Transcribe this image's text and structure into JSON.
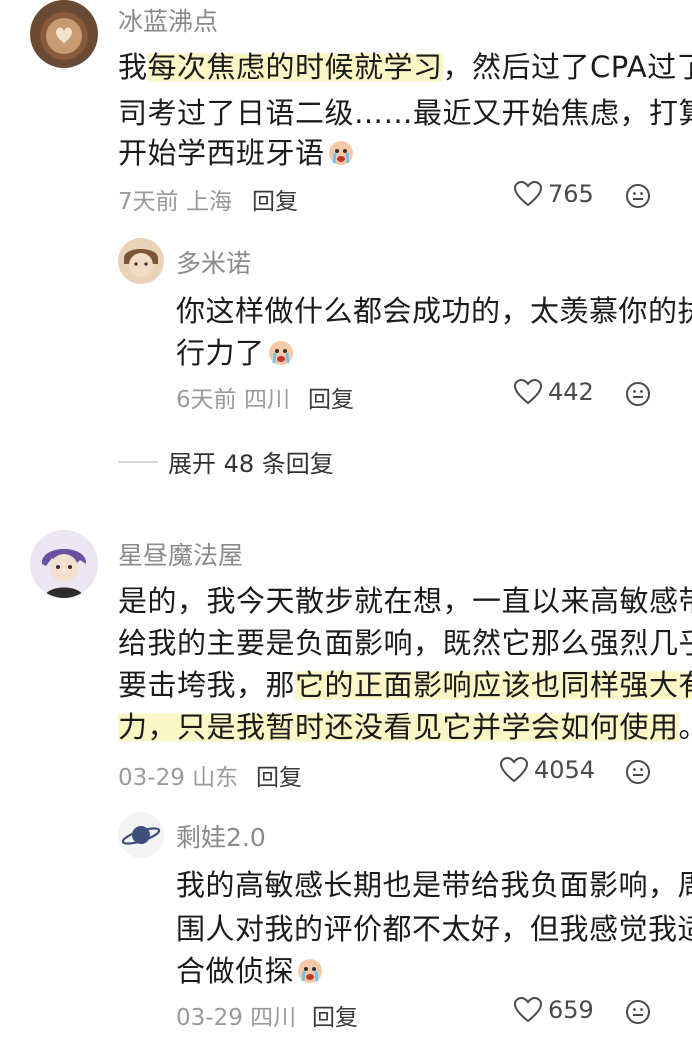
{
  "comments": [
    {
      "username": "冰蓝沸点",
      "lines": [
        {
          "plain_before": "我",
          "highlight": "每次焦虑的时候就学习",
          "plain_after": "，然后过了CPA过了"
        },
        {
          "text": "司考过了日语二级……最近又开始焦虑，打算"
        },
        {
          "text": "开始学西班牙语"
        }
      ],
      "emoji": "crying-face-emoji",
      "time": "7天前",
      "location": "上海",
      "reply_label": "回复",
      "likes": "765"
    },
    {
      "username": "多米诺",
      "lines": [
        {
          "text": "你这样做什么都会成功的，太羡慕你的执"
        },
        {
          "text": "行力了"
        }
      ],
      "emoji": "crying-face-emoji",
      "time": "6天前",
      "location": "四川",
      "reply_label": "回复",
      "likes": "442"
    },
    {
      "username": "星昼魔法屋",
      "lines": [
        {
          "text": "是的，我今天散步就在想，一直以来高敏感带"
        },
        {
          "text": "给我的主要是负面影响，既然它那么强烈几乎"
        },
        {
          "plain_before": "要击垮我，那",
          "highlight": "它的正面影响应该也同样强大有"
        },
        {
          "highlight": "力，只是我暂时还没看见它并学会如何使用",
          "plain_after": "。"
        }
      ],
      "time": "03-29",
      "location": "山东",
      "reply_label": "回复",
      "likes": "4054"
    },
    {
      "username": "剩娃2.0",
      "lines": [
        {
          "text": "我的高敏感长期也是带给我负面影响，周"
        },
        {
          "text": "围人对我的评价都不太好，但我感觉我适"
        },
        {
          "text": "合做侦探"
        }
      ],
      "emoji": "crying-face-emoji",
      "time": "03-29",
      "location": "四川",
      "reply_label": "回复",
      "likes": "659"
    }
  ],
  "expand_replies": "展开 48 条回复",
  "colors": {
    "highlight": "#fbf6c6",
    "meta_gray": "#9a9a9a",
    "name_gray": "#8a8a8a"
  }
}
